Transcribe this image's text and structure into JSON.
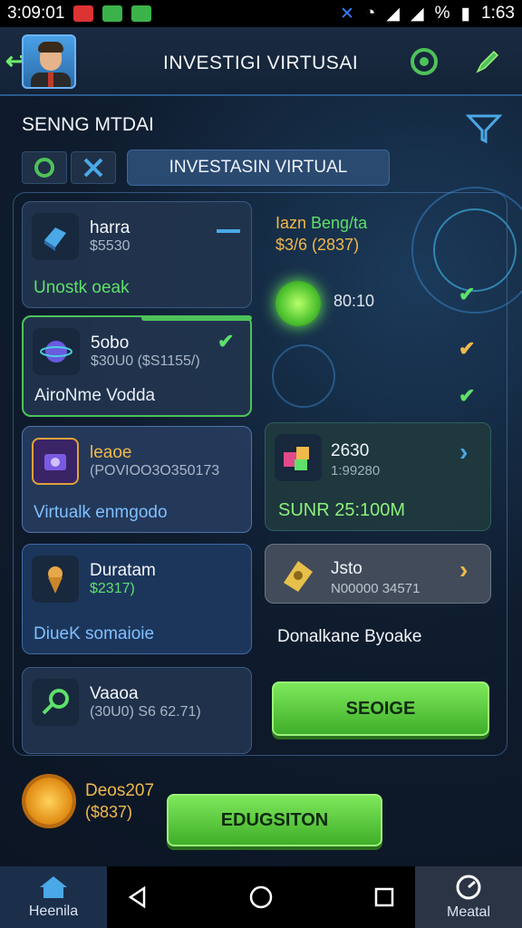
{
  "status_bar": {
    "left_text": "3:09:01",
    "right_text": "1:63",
    "battery_label": "%"
  },
  "header": {
    "title": "INVESTIGI VIRTUSAI"
  },
  "section": {
    "title": "SENNG MTDAI"
  },
  "tabs": {
    "active_label": "INVESTASIN VIRTUAL"
  },
  "left_cards": [
    {
      "title": "harra",
      "subtitle": "$5530",
      "footer": "Unostk oeak",
      "footer_color": "#5ee06b"
    },
    {
      "title": "5obo",
      "subtitle": "$30U0 ($S1155/)",
      "footer": "AiroNme Vodda",
      "footer_color": "#e8eef6"
    },
    {
      "title": "leaoe",
      "subtitle": "(POVIOO3O350173",
      "footer": "Virtualk enmgodo",
      "footer_color": "#7fc0ff"
    },
    {
      "title": "Duratam",
      "subtitle": "$2317)",
      "footer": "DiueK somaioie",
      "footer_color": "#7fc0ff"
    },
    {
      "title": "Vaaoa",
      "subtitle": "(30U0) S6 62.71)",
      "footer": "",
      "footer_color": "#e8eef6"
    }
  ],
  "right_panel": {
    "title_part1": "Iazn ",
    "title_part2": "Beng/ta",
    "subtitle": "$3/6 (2837)",
    "time": "80:10",
    "card1": {
      "title": "2630",
      "subtitle": "1:99280",
      "footer": "SUNR 25:100M"
    },
    "card2": {
      "title": "Jsto",
      "subtitle": "N00000 34571",
      "footer": "Donalkane Byoake"
    }
  },
  "buttons": {
    "primary": "SEOIGE",
    "secondary": "EDUGSITON"
  },
  "coin": {
    "line1": "Deos207",
    "line2": "($837)"
  },
  "nav": {
    "left_label": "Heenila",
    "right_label": "Meatal"
  },
  "colors": {
    "accent_green": "#4ec25a",
    "accent_gold": "#f1b94a",
    "accent_blue": "#3a7cff"
  }
}
